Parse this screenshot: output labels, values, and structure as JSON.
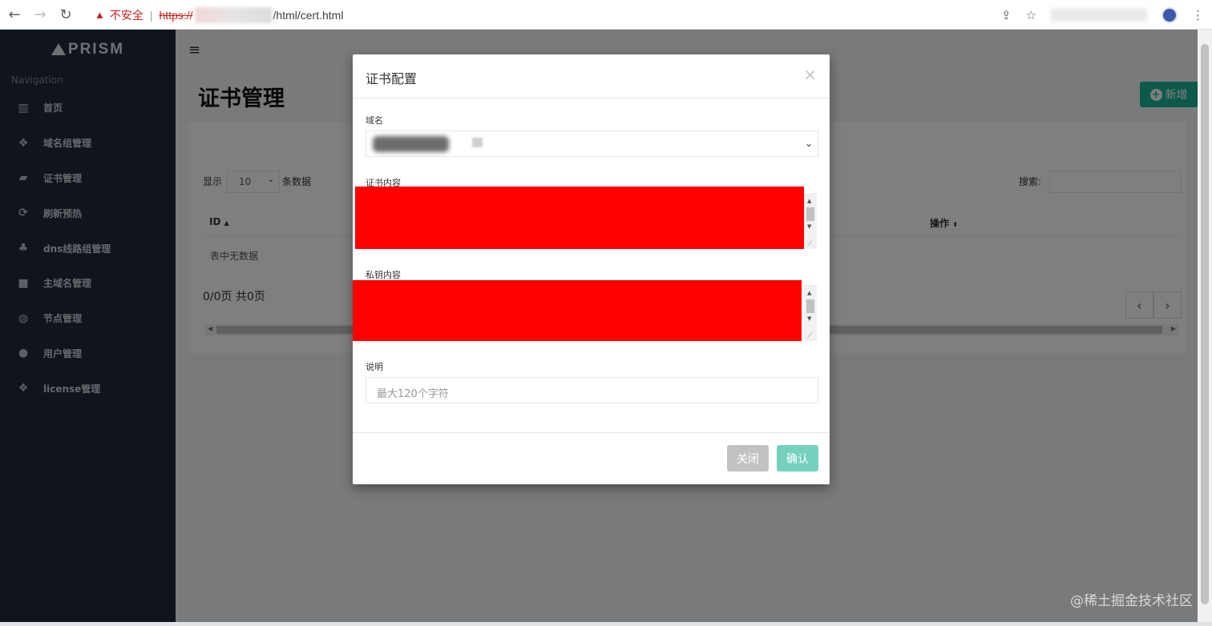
{
  "browser": {
    "insecure_label": "不安全",
    "url_scheme": "https://",
    "url_path": "/html/cert.html"
  },
  "sidebar": {
    "logo": "PRISM",
    "nav_title": "Navigation",
    "items": [
      {
        "label": "首页",
        "icon": "bar-chart-icon"
      },
      {
        "label": "域名组管理",
        "icon": "cubes-icon"
      },
      {
        "label": "证书管理",
        "icon": "book-icon"
      },
      {
        "label": "刷新预热",
        "icon": "refresh-icon"
      },
      {
        "label": "dns线路组管理",
        "icon": "tree-icon"
      },
      {
        "label": "主域名管理",
        "icon": "square-icon"
      },
      {
        "label": "节点管理",
        "icon": "dashboard-icon"
      },
      {
        "label": "用户管理",
        "icon": "user-icon"
      },
      {
        "label": "license管理",
        "icon": "dropbox-icon"
      }
    ]
  },
  "main": {
    "title": "证书管理",
    "add_button": "新增",
    "table": {
      "show_label": "显示",
      "page_length": "10",
      "entries_label": "条数据",
      "search_label": "搜索:",
      "columns": [
        "ID",
        "操作"
      ],
      "empty_text": "表中无数据",
      "page_info": "0/0页 共0页"
    }
  },
  "modal": {
    "title": "证书配置",
    "close_glyph": "×",
    "domain_label": "域名",
    "cert_label": "证书内容",
    "key_label": "私钥内容",
    "desc_label": "说明",
    "desc_placeholder": "最大120个字符",
    "close_button": "关闭",
    "confirm_button": "确认"
  },
  "watermark": "@稀土掘金技术社区",
  "colors": {
    "sidebar": "#1e2a36",
    "primary": "#1ab394",
    "redaction": "#ff0000"
  }
}
